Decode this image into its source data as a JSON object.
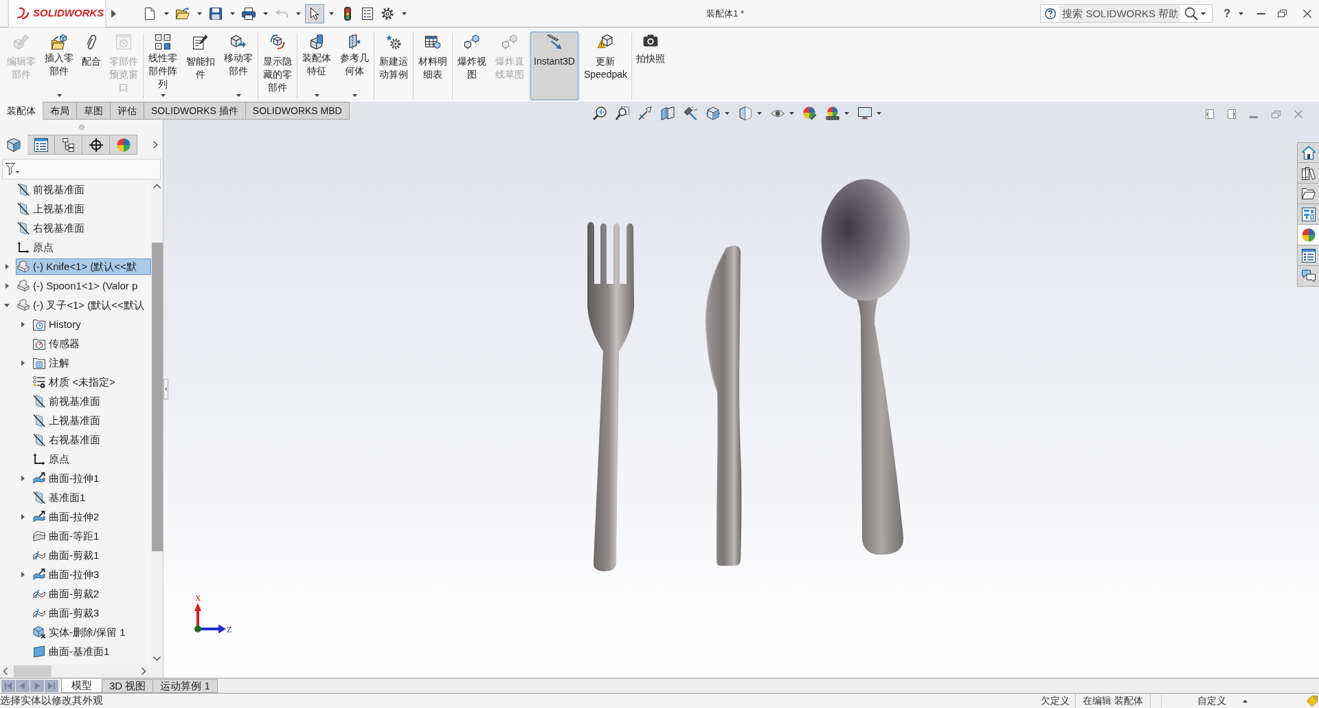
{
  "title_bar": {
    "logo": "SOLIDWORKS",
    "quick_access": [
      {
        "kind": "new",
        "dropdown": true,
        "disabled": false,
        "pressed": false
      },
      {
        "kind": "open",
        "dropdown": true,
        "disabled": false,
        "pressed": false
      },
      {
        "kind": "save",
        "dropdown": true,
        "disabled": false,
        "pressed": false
      },
      {
        "kind": "print",
        "dropdown": true,
        "disabled": false,
        "pressed": false
      },
      {
        "kind": "undo",
        "dropdown": true,
        "disabled": true,
        "pressed": false
      },
      {
        "kind": "select",
        "dropdown": true,
        "disabled": false,
        "pressed": true
      },
      {
        "kind": "rebuild",
        "dropdown": false,
        "disabled": false,
        "pressed": false
      },
      {
        "kind": "file-properties",
        "dropdown": false,
        "disabled": false,
        "pressed": false
      },
      {
        "kind": "options",
        "dropdown": true,
        "disabled": false,
        "pressed": false
      }
    ],
    "document_title": "装配体1 *",
    "search": {
      "placeholder": "搜索 SOLIDWORKS 帮助"
    },
    "help": "?"
  },
  "ribbon": {
    "groups": [
      {
        "buttons": [
          {
            "kind": "edit-component",
            "label": "编辑零部件",
            "disabled": true,
            "pressed": false,
            "dropdown": false
          },
          {
            "kind": "insert-component",
            "label": "插入零部件",
            "disabled": false,
            "pressed": false,
            "dropdown": true
          },
          {
            "kind": "mate",
            "label": "配合",
            "disabled": false,
            "pressed": false,
            "dropdown": false
          },
          {
            "kind": "component-preview",
            "label": "零部件预览窗口",
            "disabled": true,
            "pressed": false,
            "dropdown": false
          }
        ]
      },
      {
        "buttons": [
          {
            "kind": "linear-pattern",
            "label": "线性零部件阵列",
            "disabled": false,
            "pressed": false,
            "dropdown": true
          },
          {
            "kind": "smart-fasteners",
            "label": "智能扣件",
            "disabled": false,
            "pressed": false,
            "dropdown": false
          },
          {
            "kind": "move-component",
            "label": "移动零部件",
            "disabled": false,
            "pressed": false,
            "dropdown": true
          }
        ]
      },
      {
        "buttons": [
          {
            "kind": "show-hidden",
            "label": "显示隐藏的零部件",
            "disabled": false,
            "pressed": false,
            "dropdown": false
          }
        ]
      },
      {
        "buttons": [
          {
            "kind": "assembly-features",
            "label": "装配体特征",
            "disabled": false,
            "pressed": false,
            "dropdown": true
          },
          {
            "kind": "reference-geometry",
            "label": "参考几何体",
            "disabled": false,
            "pressed": false,
            "dropdown": true
          }
        ]
      },
      {
        "buttons": [
          {
            "kind": "new-motion-study",
            "label": "新建运动算例",
            "disabled": false,
            "pressed": false,
            "dropdown": false
          }
        ]
      },
      {
        "buttons": [
          {
            "kind": "bom",
            "label": "材料明细表",
            "disabled": false,
            "pressed": false,
            "dropdown": false
          }
        ]
      },
      {
        "buttons": [
          {
            "kind": "exploded-view",
            "label": "爆炸视图",
            "disabled": false,
            "pressed": false,
            "dropdown": false
          },
          {
            "kind": "explode-line-sketch",
            "label": "爆炸直线草图",
            "disabled": true,
            "pressed": false,
            "dropdown": false
          }
        ]
      },
      {
        "buttons": [
          {
            "kind": "instant3d",
            "label": "Instant3D",
            "disabled": false,
            "pressed": true,
            "dropdown": false
          }
        ]
      },
      {
        "buttons": [
          {
            "kind": "update-speedpak",
            "label": "更新\nSpeedpak",
            "disabled": false,
            "pressed": false,
            "dropdown": false
          }
        ]
      },
      {
        "buttons": [
          {
            "kind": "take-snapshot",
            "label": "拍快照",
            "disabled": false,
            "pressed": false,
            "dropdown": false
          }
        ]
      }
    ]
  },
  "command_tabs": [
    {
      "label": "装配体",
      "selected": true
    },
    {
      "label": "布局",
      "selected": false
    },
    {
      "label": "草图",
      "selected": false
    },
    {
      "label": "评估",
      "selected": false
    },
    {
      "label": "SOLIDWORKS 插件",
      "selected": false
    },
    {
      "label": "SOLIDWORKS MBD",
      "selected": false
    }
  ],
  "feature_manager": {
    "tabs": [
      {
        "kind": "feature-tree",
        "selected": true
      },
      {
        "kind": "properties",
        "selected": false
      },
      {
        "kind": "configurations",
        "selected": false
      },
      {
        "kind": "dimxpert",
        "selected": false
      },
      {
        "kind": "display",
        "selected": false
      }
    ],
    "tree": [
      {
        "label": "前视基准面",
        "kind": "plane",
        "has_children": false,
        "expanded": false,
        "selected": false
      },
      {
        "label": "上视基准面",
        "kind": "plane",
        "has_children": false,
        "expanded": false,
        "selected": false
      },
      {
        "label": "右视基准面",
        "kind": "plane",
        "has_children": false,
        "expanded": false,
        "selected": false
      },
      {
        "label": "原点",
        "kind": "origin",
        "has_children": false,
        "expanded": false,
        "selected": false
      },
      {
        "label": "(-) Knife<1> (默认<<默",
        "kind": "component",
        "has_children": true,
        "expanded": false,
        "selected": true
      },
      {
        "label": "(-) Spoon1<1> (Valor p",
        "kind": "component",
        "has_children": true,
        "expanded": false,
        "selected": false
      },
      {
        "label": "(-) 叉子<1> (默认<<默认",
        "kind": "component",
        "has_children": true,
        "expanded": true,
        "selected": false,
        "children": [
          {
            "label": "History",
            "kind": "history",
            "has_children": true,
            "expanded": false,
            "selected": false
          },
          {
            "label": "传感器",
            "kind": "sensors",
            "has_children": false,
            "expanded": false,
            "selected": false
          },
          {
            "label": "注解",
            "kind": "annotations",
            "has_children": true,
            "expanded": false,
            "selected": false
          },
          {
            "label": "材质 <未指定>",
            "kind": "material",
            "has_children": false,
            "expanded": false,
            "selected": false
          },
          {
            "label": "前视基准面",
            "kind": "plane",
            "has_children": false,
            "expanded": false,
            "selected": false
          },
          {
            "label": "上视基准面",
            "kind": "plane",
            "has_children": false,
            "expanded": false,
            "selected": false
          },
          {
            "label": "右视基准面",
            "kind": "plane",
            "has_children": false,
            "expanded": false,
            "selected": false
          },
          {
            "label": "原点",
            "kind": "origin",
            "has_children": false,
            "expanded": false,
            "selected": false
          },
          {
            "label": "曲面-拉伸1",
            "kind": "surface-extrude",
            "has_children": true,
            "expanded": false,
            "selected": false
          },
          {
            "label": "基准面1",
            "kind": "plane",
            "has_children": false,
            "expanded": false,
            "selected": false
          },
          {
            "label": "曲面-拉伸2",
            "kind": "surface-extrude",
            "has_children": true,
            "expanded": false,
            "selected": false
          },
          {
            "label": "曲面-等距1",
            "kind": "surface-offset",
            "has_children": false,
            "expanded": false,
            "selected": false
          },
          {
            "label": "曲面-剪裁1",
            "kind": "surface-trim",
            "has_children": false,
            "expanded": false,
            "selected": false
          },
          {
            "label": "曲面-拉伸3",
            "kind": "surface-extrude",
            "has_children": true,
            "expanded": false,
            "selected": false
          },
          {
            "label": "曲面-剪裁2",
            "kind": "surface-trim",
            "has_children": false,
            "expanded": false,
            "selected": false
          },
          {
            "label": "曲面-剪裁3",
            "kind": "surface-trim",
            "has_children": false,
            "expanded": false,
            "selected": false
          },
          {
            "label": "实体-删除/保留 1",
            "kind": "delete-body",
            "has_children": false,
            "expanded": false,
            "selected": false
          },
          {
            "label": "曲面-基准面1",
            "kind": "surface-plane",
            "has_children": false,
            "expanded": false,
            "selected": false
          }
        ]
      }
    ]
  },
  "view_toolbar": [
    {
      "kind": "zoom-fit",
      "dropdown": false
    },
    {
      "kind": "zoom-area",
      "dropdown": false
    },
    {
      "kind": "previous-view",
      "dropdown": false
    },
    {
      "kind": "section-view",
      "dropdown": false
    },
    {
      "kind": "dynamic-annotation",
      "dropdown": false
    },
    {
      "kind": "view-orientation",
      "dropdown": true
    },
    {
      "kind": "display-style",
      "dropdown": true
    },
    {
      "kind": "hide-show",
      "dropdown": true
    },
    {
      "kind": "edit-appearance",
      "dropdown": false
    },
    {
      "kind": "apply-scene",
      "dropdown": true
    },
    {
      "kind": "view-settings",
      "dropdown": true
    }
  ],
  "task_pane": [
    {
      "kind": "home",
      "selected": false
    },
    {
      "kind": "design-library",
      "selected": false
    },
    {
      "kind": "file-explorer",
      "selected": false
    },
    {
      "kind": "view-palette",
      "selected": false
    },
    {
      "kind": "appearances",
      "selected": true
    },
    {
      "kind": "custom-properties",
      "selected": false
    },
    {
      "kind": "forum",
      "selected": false
    }
  ],
  "models": [
    {
      "kind": "fork"
    },
    {
      "kind": "knife"
    },
    {
      "kind": "spoon"
    }
  ],
  "triad": {
    "x_label": "X",
    "z_label": "Z"
  },
  "bottom_tabs": [
    {
      "label": "模型",
      "selected": true
    },
    {
      "label": "3D 视图",
      "selected": false
    },
    {
      "label": "运动算例 1",
      "selected": false
    }
  ],
  "status_bar": {
    "message": "选择实体以修改其外观",
    "fields": [
      "欠定义",
      "在编辑 装配体",
      "自定义"
    ]
  }
}
